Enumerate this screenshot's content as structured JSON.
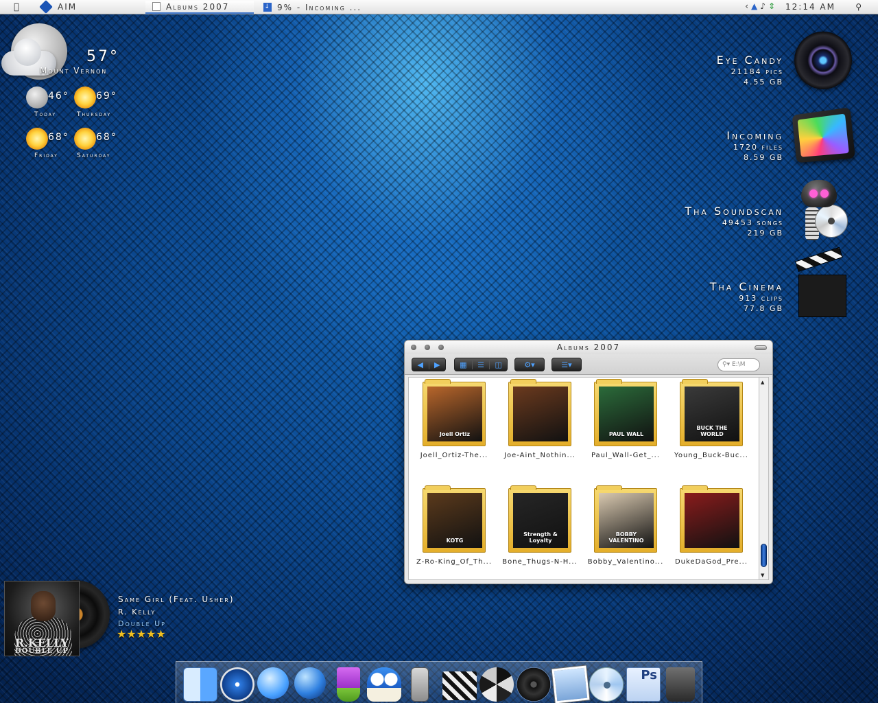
{
  "menubar": {
    "app_name": "AIM",
    "tabs": [
      {
        "label": "Albums 2007"
      },
      {
        "label": "9% - Incoming ..."
      }
    ],
    "clock": "12:14 AM"
  },
  "weather": {
    "current_temp": "57°",
    "city": "Mount Vernon",
    "forecast": [
      {
        "day": "Today",
        "temp": "46°",
        "icon": "moon-icon"
      },
      {
        "day": "Thursday",
        "temp": "69°",
        "icon": "sun-icon"
      },
      {
        "day": "Friday",
        "temp": "68°",
        "icon": "sun-icon"
      },
      {
        "day": "Saturday",
        "temp": "68°",
        "icon": "sun-icon"
      }
    ]
  },
  "drives": [
    {
      "title": "Eye Candy",
      "line1": "21184 pics",
      "line2": "4.55 GB",
      "icon": "camera-lens-icon"
    },
    {
      "title": "Incoming",
      "line1": "1720 files",
      "line2": "8.59 GB",
      "icon": "incoming-drive-icon"
    },
    {
      "title": "Tha Soundscan",
      "line1": "49453 songs",
      "line2": "219 GB",
      "icon": "robot-disc-icon"
    },
    {
      "title": "Tha Cinema",
      "line1": "913 clips",
      "line2": "77.8 GB",
      "icon": "clapperboard-icon"
    }
  ],
  "finder": {
    "title": "Albums 2007",
    "search_placeholder": "E:\\M",
    "albums": [
      {
        "name": "Joell_Ortiz-The...",
        "cover_text": "Joell Ortiz",
        "color": "#b8662b"
      },
      {
        "name": "Joe-Aint_Nothin...",
        "cover_text": "",
        "color": "#6b3a1e"
      },
      {
        "name": "Paul_Wall-Get_...",
        "cover_text": "PAUL WALL",
        "color": "#2b6b3a"
      },
      {
        "name": "Young_Buck-Buc...",
        "cover_text": "BUCK THE WORLD",
        "color": "#3a3a3a"
      },
      {
        "name": "Z-Ro-King_Of_Th...",
        "cover_text": "KOTG",
        "color": "#5b3a1c"
      },
      {
        "name": "Bone_Thugs-N-H...",
        "cover_text": "Strength & Loyalty",
        "color": "#262626"
      },
      {
        "name": "Bobby_Valentino...",
        "cover_text": "BOBBY VALENTINO",
        "color": "#d9c9b0"
      },
      {
        "name": "DukeDaGod_Pre...",
        "cover_text": "",
        "color": "#8a1c1c"
      }
    ]
  },
  "now_playing": {
    "track": "Same Girl (Feat. Usher)",
    "artist": "R. Kelly",
    "album": "Double Up",
    "rating": "★★★★★",
    "cover_band": "R.KELLY",
    "cover_title": "DOUBLE UP"
  },
  "dock": [
    {
      "name": "finder-icon"
    },
    {
      "name": "safari-icon"
    },
    {
      "name": "ichat-icon"
    },
    {
      "name": "globe-icon"
    },
    {
      "name": "slushie-icon"
    },
    {
      "name": "mushroom-icon"
    },
    {
      "name": "phone-icon"
    },
    {
      "name": "clapperboard-icon"
    },
    {
      "name": "aperture-icon"
    },
    {
      "name": "dvd-player-icon"
    },
    {
      "name": "photos-icon"
    },
    {
      "name": "cd-icon"
    },
    {
      "name": "photoshop-icon"
    },
    {
      "name": "trash-icon"
    }
  ],
  "dock_labels": {
    "photoshop": "Ps"
  }
}
